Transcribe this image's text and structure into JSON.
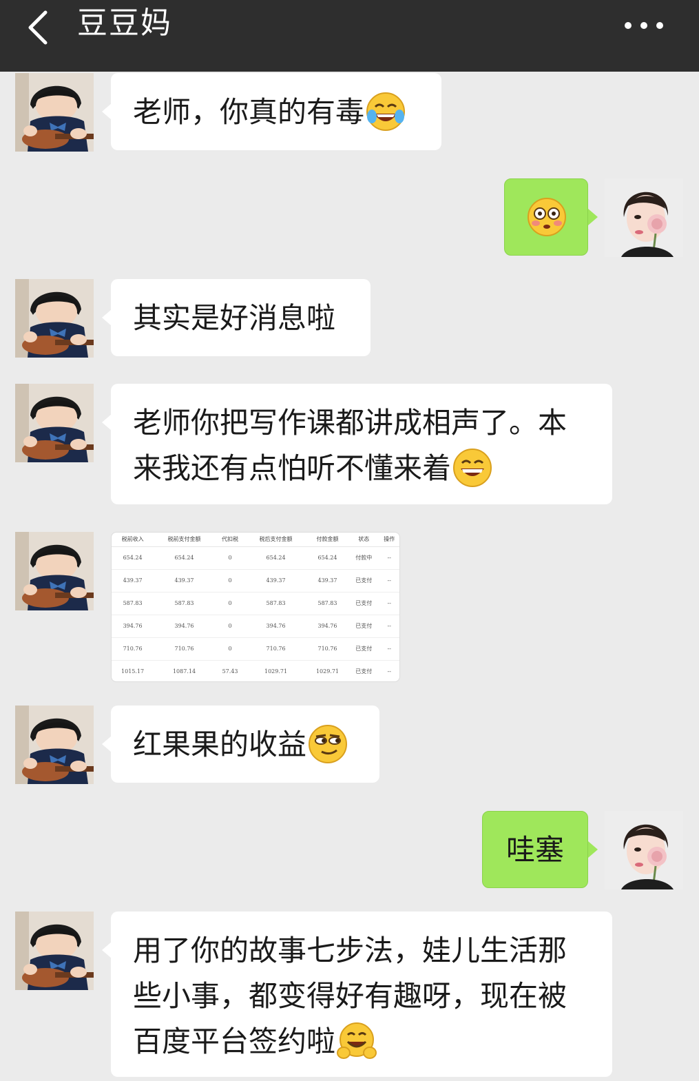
{
  "header": {
    "title": "豆豆妈",
    "back_icon": "chevron-left-icon",
    "more_icon": "more-dots-icon"
  },
  "colors": {
    "header_bg": "#2e2e2e",
    "chat_bg": "#ebebeb",
    "sent_bubble": "#9fe75b",
    "received_bubble": "#ffffff"
  },
  "messages": [
    {
      "side": "left",
      "text": "老师，你真的有毒",
      "emoji": "tears-of-joy-emoji"
    },
    {
      "side": "right",
      "text": "",
      "emoji": "flushed-emoji"
    },
    {
      "side": "left",
      "text": "其实是好消息啦"
    },
    {
      "side": "left",
      "line1": "老师你把写作课都讲成相声了。本",
      "line2": "来我还有点怕听不懂来着",
      "emoji": "grinning-emoji"
    },
    {
      "side": "left",
      "type": "image",
      "table": {
        "headers": [
          "税前收入",
          "税前支付金额",
          "代扣税",
          "税后支付金额",
          "付款金额",
          "状态",
          "操作"
        ],
        "rows": [
          [
            "654.24",
            "654.24",
            "0",
            "654.24",
            "654.24",
            "付款中",
            "--"
          ],
          [
            "439.37",
            "439.37",
            "0",
            "439.37",
            "439.37",
            "已支付",
            "--"
          ],
          [
            "587.83",
            "587.83",
            "0",
            "587.83",
            "587.83",
            "已支付",
            "--"
          ],
          [
            "394.76",
            "394.76",
            "0",
            "394.76",
            "394.76",
            "已支付",
            "--"
          ],
          [
            "710.76",
            "710.76",
            "0",
            "710.76",
            "710.76",
            "已支付",
            "--"
          ],
          [
            "1015.17",
            "1087.14",
            "57.43",
            "1029.71",
            "1029.71",
            "已支付",
            "--"
          ]
        ]
      }
    },
    {
      "side": "left",
      "text": "红果果的收益",
      "emoji": "smirk-emoji"
    },
    {
      "side": "right",
      "text": "哇塞"
    },
    {
      "side": "left",
      "line1": "用了你的故事七步法，娃儿生活那",
      "line2": "些小事，都变得好有趣呀，现在被",
      "line3": "百度平台签约啦",
      "emoji": "hugging-emoji"
    }
  ]
}
